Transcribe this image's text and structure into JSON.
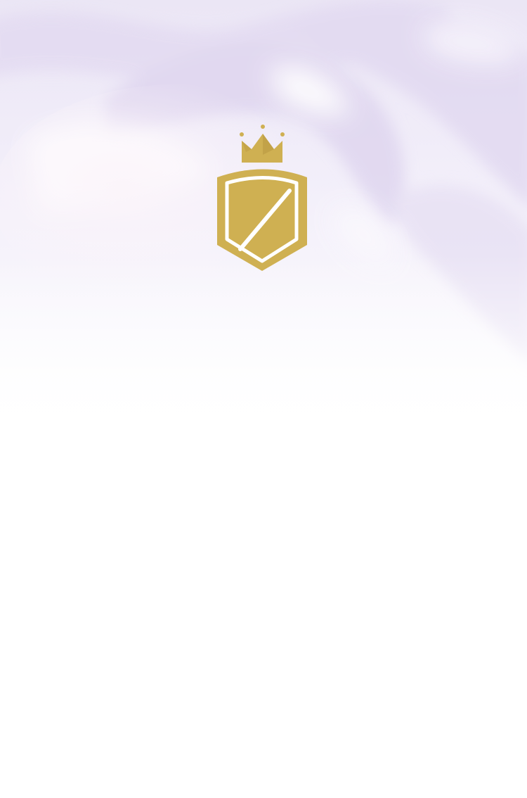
{
  "app": {
    "screen": "splash"
  },
  "background": {
    "style": "lavender-silk",
    "colors": {
      "top": "#ede8f6",
      "mid": "#f3effa",
      "fold": "#ddd3ef",
      "highlight": "#ffffff",
      "base": "#ffffff"
    }
  },
  "logo": {
    "icons": [
      "crown-icon",
      "shield-icon"
    ],
    "colors": {
      "gold": "#cfb052",
      "gold_dark": "#b49338",
      "inner": "#ffffff"
    }
  }
}
